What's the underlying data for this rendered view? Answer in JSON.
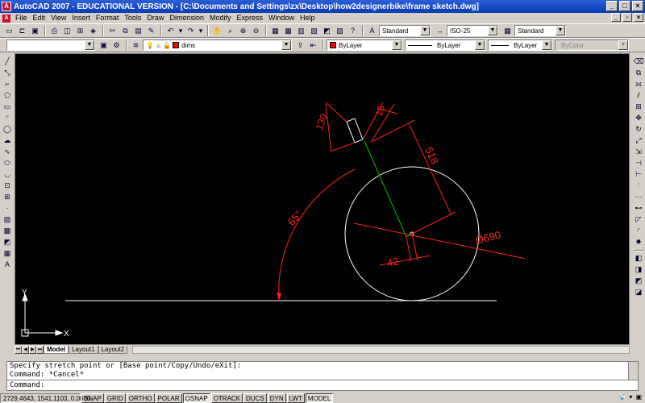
{
  "titlebar": {
    "title": "AutoCAD 2007 - EDUCATIONAL VERSION - [C:\\Documents and Settings\\zx\\Desktop\\how2designerbike\\frame sketch.dwg]",
    "app_icon": "A",
    "doc_icon": "A"
  },
  "menu": [
    "File",
    "Edit",
    "View",
    "Insert",
    "Format",
    "Tools",
    "Draw",
    "Dimension",
    "Modify",
    "Express",
    "Window",
    "Help"
  ],
  "toolbar_standard": {
    "text_style": "Standard",
    "dim_style": "ISO-25",
    "table_style": "Standard"
  },
  "layers_toolbar": {
    "workspace_value": "",
    "layer_value": "dims"
  },
  "properties_toolbar": {
    "color": "ByLayer",
    "linetype": "ByLayer",
    "lineweight": "ByLayer",
    "plotstyle": "ByColor"
  },
  "drawing": {
    "dim_130": "130",
    "dim_15": "15",
    "dim_518": "518",
    "dim_65": "65°",
    "dim_690": "Ø690",
    "dim_42": "42",
    "ucs_x": "X",
    "ucs_y": "Y",
    "colors": {
      "background": "#000000",
      "geometry": "#ffffff",
      "dimension": "#ff2020",
      "centerline": "#00c000"
    }
  },
  "layout_tabs": [
    "Model",
    "Layout1",
    "Layout2"
  ],
  "command": {
    "history_1": "Specify stretch point or [Base point/Copy/Undo/eXit]:",
    "history_2": "Command: *Cancel*",
    "prompt": "Command:"
  },
  "statusbar": {
    "coordinates": "2729.4643, 1541.1103, 0.0000",
    "buttons": [
      "SNAP",
      "GRID",
      "ORTHO",
      "POLAR",
      "OSNAP",
      "OTRACK",
      "DUCS",
      "DYN",
      "LWT",
      "MODEL"
    ]
  }
}
